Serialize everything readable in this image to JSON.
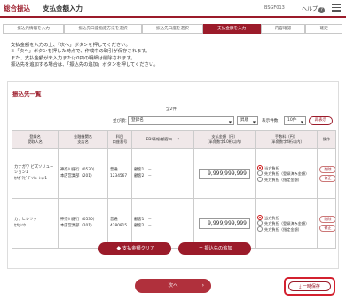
{
  "header": {
    "section": "総合振込",
    "title": "支払金額入力",
    "screen_id": "BSGF013",
    "help": "ヘルプ"
  },
  "steps": [
    "振込元情報を入力",
    "振込先口座指定方法を選択",
    "振込先口座を選択",
    "支払金額を入力",
    "内容確認",
    "確定"
  ],
  "current_step": 3,
  "instructions": [
    "支払金額を入力の上、「次へ」ボタンを押してください。",
    "※「次へ」ボタンを押した時点で、作成中の取引が保存されます。",
    "また、支払金額が未入力または0円の明細は削除されます。",
    "振込先を追加する場合は、「振込先の追加」ボタンを押してください。"
  ],
  "list": {
    "title": "振込先一覧",
    "count": "全2件",
    "sort_label": "並び順：",
    "sort_value": "登録名",
    "order_value": "昇順",
    "per_page_label": "表示件数：",
    "per_page_value": "10件",
    "redisplay": "再表示"
  },
  "columns": [
    "登録名\n受取人名",
    "金融機関名\n支店名",
    "科目\n口座番号",
    "EDI情報/顧客コード",
    "支払金額（円）\n（半角数字10桁以内）",
    "手数料（円）\n（半角数字4桁以内）",
    "操作"
  ],
  "rows": [
    {
      "name": "カナガワ ビズソリューション1",
      "kana": "ｶﾅｶﾞﾜﾋﾞｽﾞｿﾘｭｰｼｮﾝ1",
      "bank": "神奈川銀行（0530）",
      "branch": "本店営業部（201）",
      "type": "普通",
      "account": "1234567",
      "edi1": "顧客1：－",
      "edi2": "顧客2：－",
      "amount": "9,999,999,999"
    },
    {
      "name": "カナヒレツク",
      "kana": "ｶﾅﾋﾚﾂｸ",
      "bank": "神奈川銀行（0530）",
      "branch": "本店営業部（201）",
      "type": "普通",
      "account": "4280815",
      "edi1": "顧客1：－",
      "edi2": "顧客2：－",
      "amount": "9,999,999,999"
    }
  ],
  "fee_options": [
    "当方負担",
    "先方負担（登録済み金額）",
    "先方負担（指定金額）"
  ],
  "ops": {
    "delete": "削除",
    "edit": "修正"
  },
  "buttons": {
    "clear": "支払金額クリア",
    "add": "振込先の追加",
    "next": "次へ",
    "save": "一時保存"
  },
  "colors": {
    "accent": "#9b1b2a",
    "highlight": "#d3212f"
  }
}
